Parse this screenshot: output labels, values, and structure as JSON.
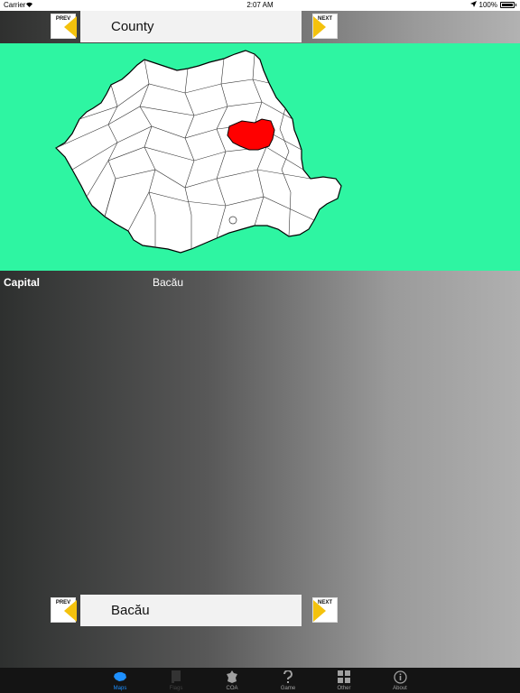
{
  "status_bar": {
    "carrier": "Carrier",
    "time": "2:07 AM",
    "battery": "100%"
  },
  "header": {
    "prev_label": "PREV",
    "next_label": "NEXT",
    "title": "County"
  },
  "map": {
    "land_color": "#ffffff",
    "highlight_color": "#ff0000",
    "water_color": "#2ef5a2",
    "highlighted_county": "Bacău"
  },
  "info": {
    "label": "Capital",
    "value": "Bacău"
  },
  "footer_nav": {
    "prev_label": "PREV",
    "next_label": "NEXT",
    "current": "Bacău"
  },
  "tabs": [
    {
      "label": "Maps",
      "icon": "map-icon",
      "state": "active"
    },
    {
      "label": "Flags",
      "icon": "flag-icon",
      "state": "disabled"
    },
    {
      "label": "COA",
      "icon": "coat-of-arms-icon",
      "state": "normal"
    },
    {
      "label": "Game",
      "icon": "question-icon",
      "state": "normal"
    },
    {
      "label": "Other",
      "icon": "grid-icon",
      "state": "normal"
    },
    {
      "label": "About",
      "icon": "info-icon",
      "state": "normal"
    }
  ]
}
